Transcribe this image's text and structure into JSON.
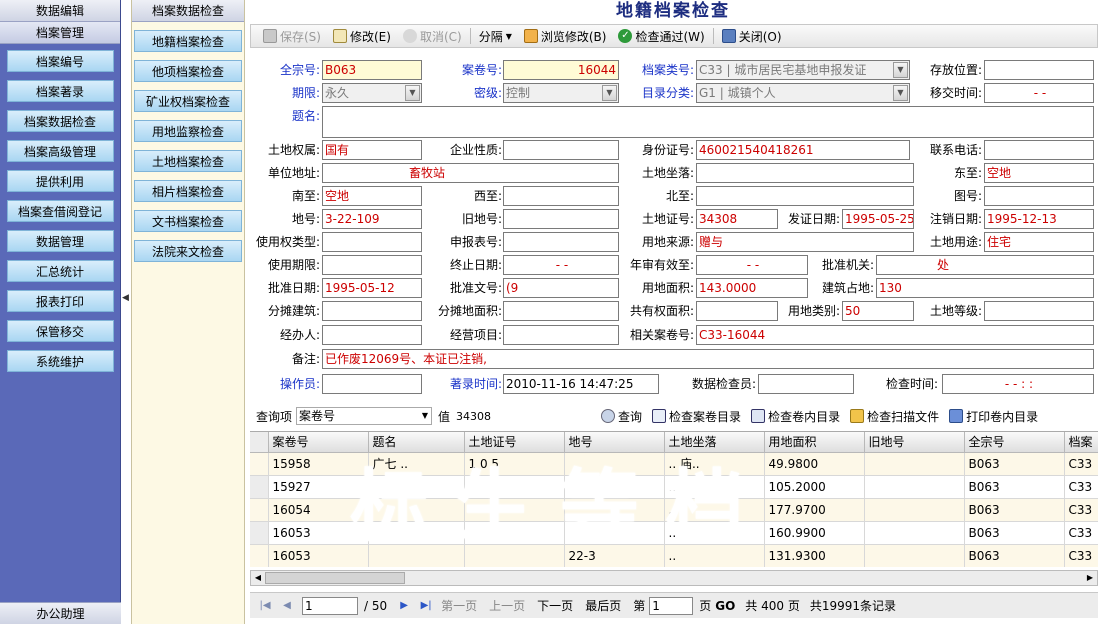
{
  "left_nav": {
    "top_title": "数据编辑",
    "section_title": "档案管理",
    "items": [
      "档案编号",
      "档案著录",
      "档案数据检查",
      "档案高级管理",
      "提供利用",
      "档案查借阅登记",
      "数据管理",
      "汇总统计",
      "报表打印",
      "保管移交",
      "系统维护"
    ],
    "bottom": "办公助理"
  },
  "sub_nav": {
    "title": "档案数据检查",
    "items": [
      "地籍档案检查",
      "他项档案检查",
      "矿业权档案检查",
      "用地监察检查",
      "土地档案检查",
      "相片档案检查",
      "文书档案检查",
      "法院来文检查"
    ]
  },
  "window_title": "地籍档案检查",
  "toolbar": {
    "save": "保存(S)",
    "edit": "修改(E)",
    "cancel": "取消(C)",
    "split": "分隔",
    "browse_edit": "浏览修改(B)",
    "check_pass": "检查通过(W)",
    "close": "关闭(O)"
  },
  "form": {
    "quanzonghao_label": "全宗号:",
    "quanzonghao": "B063",
    "anjuanhao_label": "案卷号:",
    "anjuanhao": "16044",
    "dangan_leihao_label": "档案类号:",
    "dangan_leihao": "C33 | 城市居民宅基地申报发证",
    "cunfang_label": "存放位置:",
    "cunfang": "",
    "qixian_label": "期限:",
    "qixian": "永久",
    "miji_label": "密级:",
    "miji": "控制",
    "mulu_label": "目录分类:",
    "mulu": "G1 | 城镇个人",
    "yijiao_label": "移交时间:",
    "yijiao": "- -",
    "timing_label": "题名:",
    "timing": "",
    "tudi_quanshu_label": "土地权属:",
    "tudi_quanshu": "国有",
    "qiye_label": "企业性质:",
    "qiye": "",
    "shenfen_label": "身份证号:",
    "shenfen": "460021540418261",
    "lianxi_label": "联系电话:",
    "lianxi": "",
    "danwei_label": "单位地址:",
    "danwei": "畜牧站",
    "zuoluo_label": "土地坐落:",
    "zuoluo": "",
    "dongzhi_label": "东至:",
    "dongzhi": "空地",
    "nanzhi_label": "南至:",
    "nanzhi": "空地",
    "xizhi_label": "西至:",
    "xizhi": "",
    "beizhi_label": "北至:",
    "beizhi": "",
    "tuhao_label": "图号:",
    "tuhao": "",
    "dihao_label": "地号:",
    "dihao": "3-22-109",
    "jiudihao_label": "旧地号:",
    "jiudihao": "",
    "tudizheng_label": "土地证号:",
    "tudizheng": "34308",
    "fazheng_label": "发证日期:",
    "fazheng": "1995-05-25",
    "zhuxiao_label": "注销日期:",
    "zhuxiao": "1995-12-13",
    "shiyongquan_label": "使用权类型:",
    "shiyongquan": "",
    "shenbao_label": "申报表号:",
    "shenbao": "",
    "yongdi_laiyuan_label": "用地来源:",
    "yongdi_laiyuan": "赠与",
    "yongtu_label": "土地用途:",
    "yongtu": "住宅",
    "shiyong_qixian_label": "使用期限:",
    "shiyong_qixian": "",
    "zhongzhi_label": "终止日期:",
    "zhongzhi": "- -",
    "nianshen_label": "年审有效至:",
    "nianshen": "- -",
    "pizhun_jiguan_label": "批准机关:",
    "pizhun_jiguan": "处",
    "pizhun_riqi_label": "批准日期:",
    "pizhun_riqi": "1995-05-12",
    "pizhun_wenhao_label": "批准文号:",
    "pizhun_wenhao": "(9",
    "yongdi_mianji_label": "用地面积:",
    "yongdi_mianji": "143.0000",
    "jianzhu_zhandi_label": "建筑占地:",
    "jianzhu_zhandi": "130",
    "fentan_jianzhu_label": "分摊建筑:",
    "fentan_jianzhu": "",
    "fentan_mianji_label": "分摊地面积:",
    "fentan_mianji": "",
    "gongyou_label": "共有权面积:",
    "gongyou": "",
    "yongdi_leibie_label": "用地类别:",
    "yongdi_leibie": "50",
    "tudi_dengji_label": "土地等级:",
    "tudi_dengji": "",
    "jingban_label": "经办人:",
    "jingban": "",
    "jingying_label": "经营项目:",
    "jingying": "",
    "xiangguan_label": "相关案卷号:",
    "xiangguan": "C33-16044",
    "beizhu_label": "备注:",
    "beizhu": "已作废12069号、本证已注销,",
    "caozuoyuan_label": "操作员:",
    "caozuoyuan": "",
    "zhulu_label": "著录时间:",
    "zhulu": "2010-11-16 14:47:25",
    "jianchayuan_label": "数据检查员:",
    "jianchayuan": "",
    "jiancha_time_label": "检查时间:",
    "jiancha_time": "- -   : :"
  },
  "query": {
    "field_label": "查询项",
    "field_value": "案卷号",
    "value_label": "值",
    "value": "34308",
    "search": "查询",
    "check_dir": "检查案卷目录",
    "check_inner": "检查卷内目录",
    "check_scan": "检查扫描文件",
    "print_inner": "打印卷内目录"
  },
  "table": {
    "columns": [
      "案卷号",
      "题名",
      "土地证号",
      "地号",
      "土地坐落",
      "用地面积",
      "旧地号",
      "全宗号",
      "档案"
    ],
    "rows": [
      [
        "15958",
        "广七 ..",
        "1 0 5",
        "",
        ".. 庙..",
        "49.9800",
        "",
        "B063",
        "C33"
      ],
      [
        "15927",
        "",
        "",
        "",
        "..",
        "105.2000",
        "",
        "B063",
        "C33"
      ],
      [
        "16054",
        "",
        "",
        "",
        "..",
        "177.9700",
        "",
        "B063",
        "C33"
      ],
      [
        "16053",
        "",
        "",
        "",
        "..",
        "160.9900",
        "",
        "B063",
        "C33"
      ],
      [
        "16053",
        "",
        "",
        "22-3",
        "..",
        "131.9300",
        "",
        "B063",
        "C33"
      ]
    ]
  },
  "pager": {
    "page_input": "1",
    "total_pages_text": "/ 50",
    "first": "第一页",
    "prev": "上一页",
    "next": "下一页",
    "last": "最后页",
    "goto_prefix": "第",
    "goto_input": "1",
    "goto_suffix": "页",
    "go": "GO",
    "total": "共 400 页",
    "records": "共19991条记录"
  },
  "watermark": "标 生 等 档"
}
